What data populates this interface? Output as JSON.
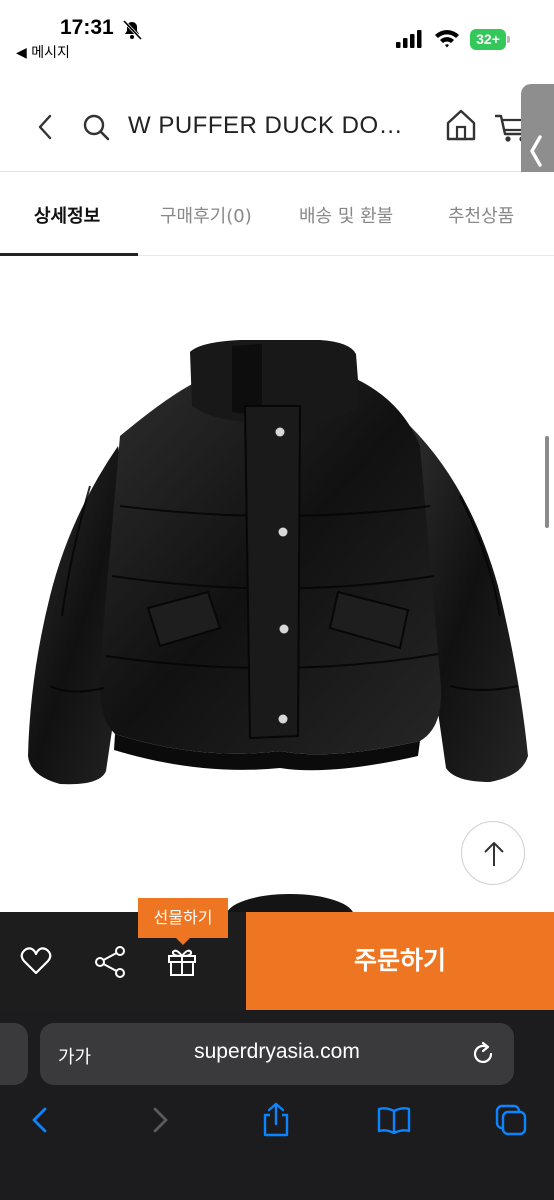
{
  "status_bar": {
    "time": "17:31",
    "back_app": "◀ 메시지",
    "battery": "32+"
  },
  "header": {
    "title": "W PUFFER DUCK DOWN JACKET",
    "icons": [
      "back-icon",
      "search-icon",
      "home-icon",
      "cart-icon"
    ]
  },
  "tabs": [
    {
      "label": "상세정보",
      "active": true
    },
    {
      "label": "구매후기(0)",
      "active": false
    },
    {
      "label": "배송 및 환불",
      "active": false
    },
    {
      "label": "추천상품",
      "active": false
    }
  ],
  "product": {
    "image": "black puffer jacket"
  },
  "actions": {
    "gift_tooltip": "선물하기",
    "order_label": "주문하기",
    "icons": [
      "heart-icon",
      "share-icon",
      "gift-icon"
    ]
  },
  "browser": {
    "aa_label": "가가",
    "url": "superdryasia.com"
  },
  "colors": {
    "accent": "#ee7622",
    "action_bar": "#1d1d1d",
    "safari_bg": "#1c1c1e",
    "link_blue": "#0a84ff"
  }
}
